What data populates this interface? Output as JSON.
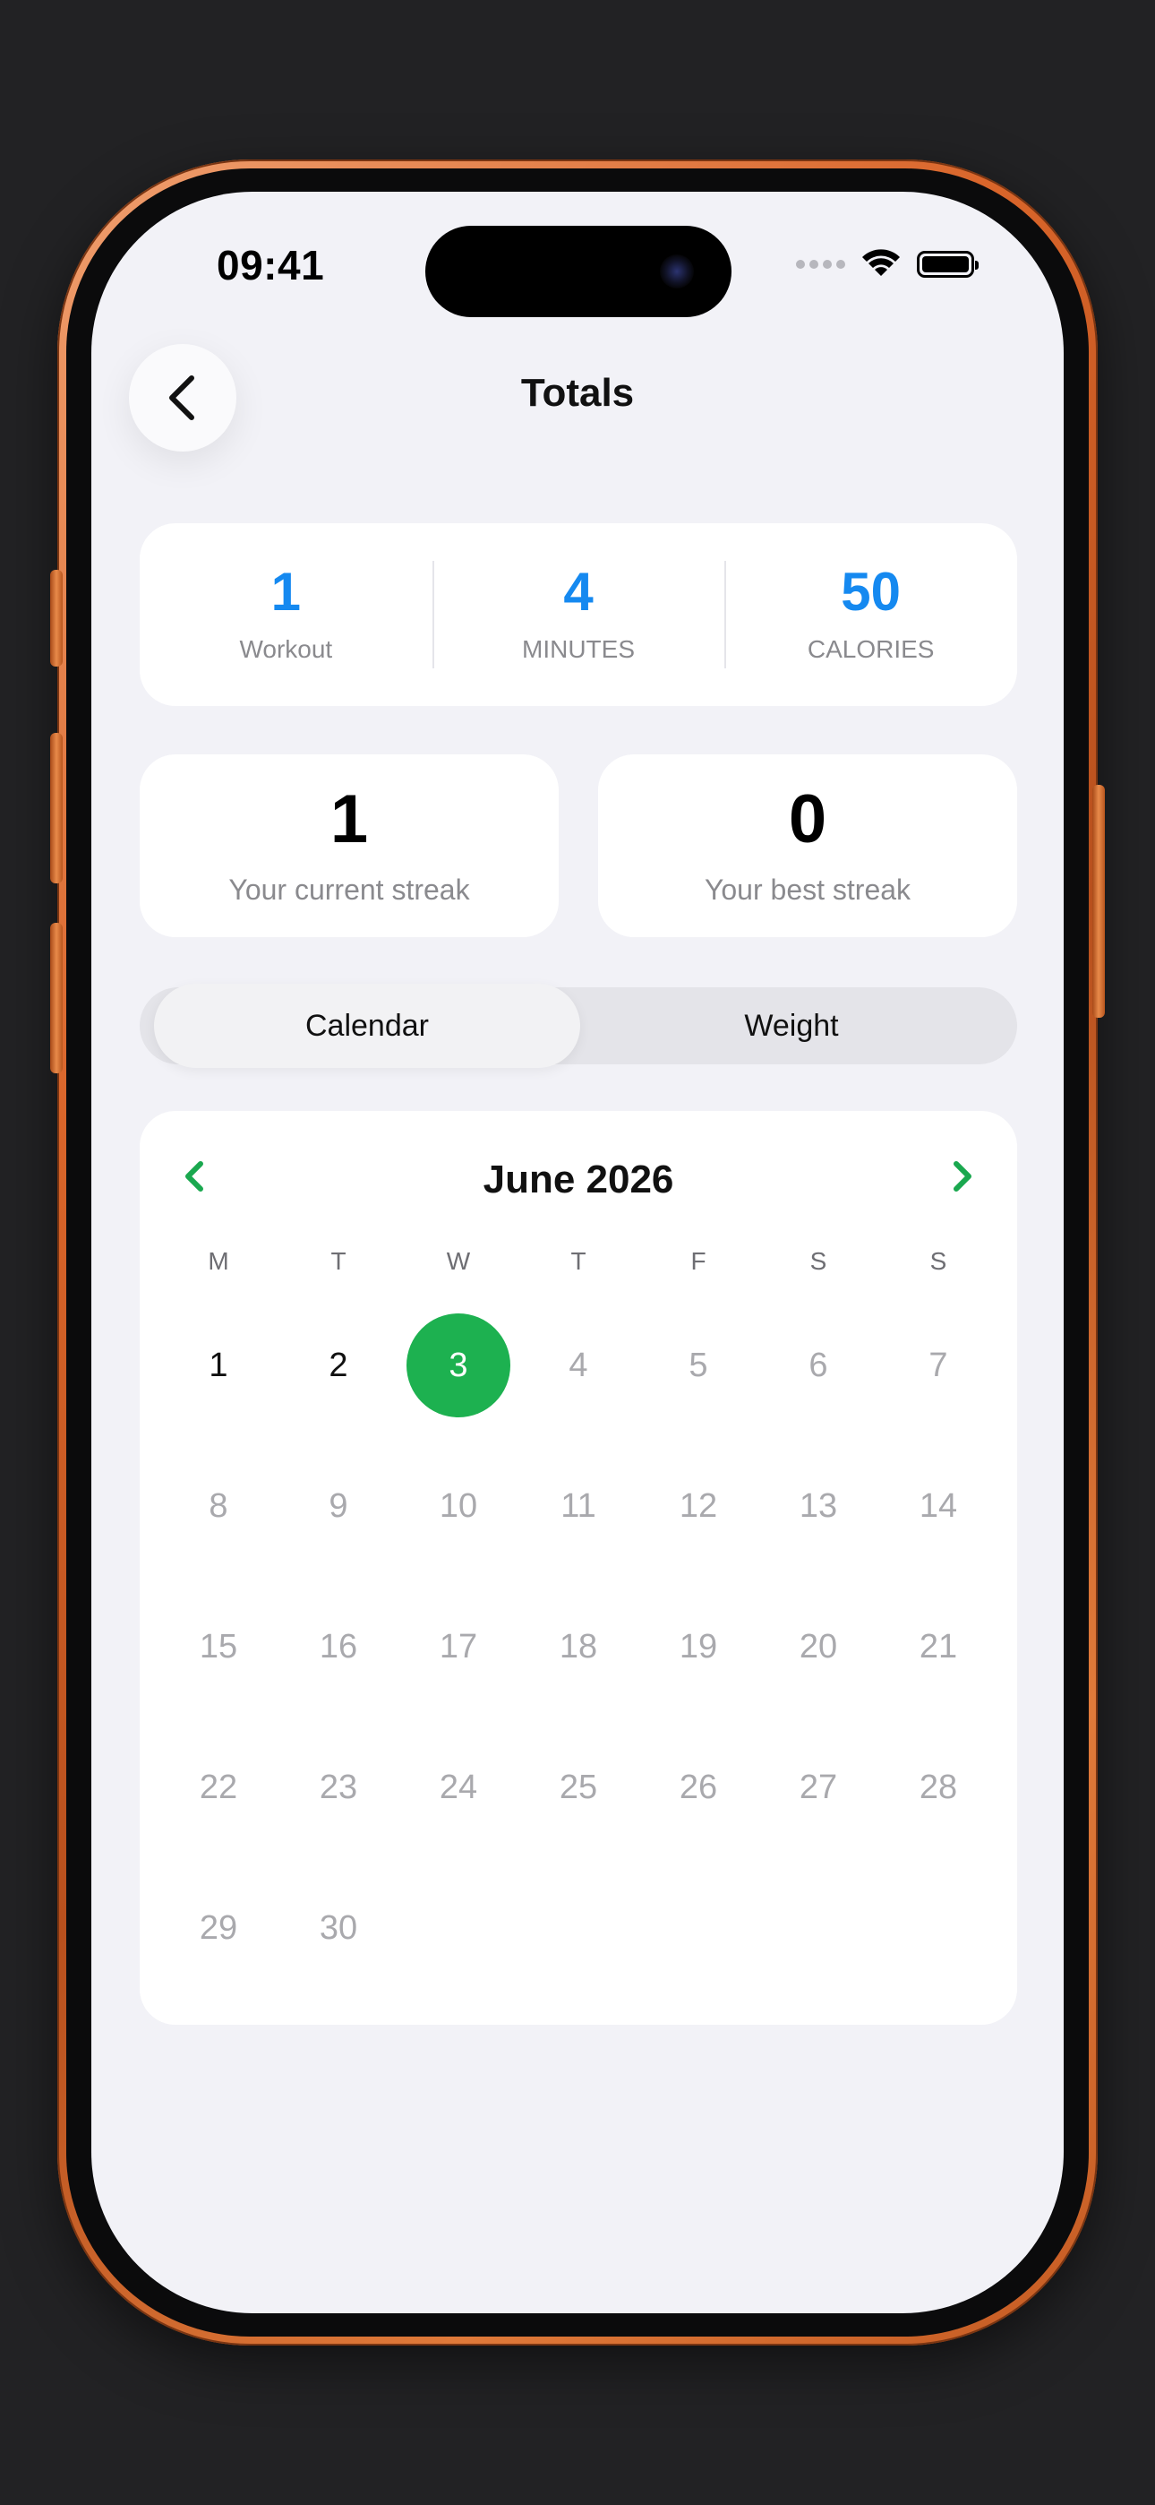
{
  "status_bar": {
    "time": "09:41"
  },
  "header": {
    "title": "Totals",
    "back_icon": "chevron-left-icon"
  },
  "totals": [
    {
      "value": "1",
      "label": "Workout"
    },
    {
      "value": "4",
      "label": "MINUTES"
    },
    {
      "value": "50",
      "label": "CALORIES"
    }
  ],
  "streaks": {
    "current": {
      "value": "1",
      "label": "Your current streak"
    },
    "best": {
      "value": "0",
      "label": "Your best streak"
    }
  },
  "tabs": {
    "items": [
      "Calendar",
      "Weight"
    ],
    "selected": "Calendar"
  },
  "calendar": {
    "month_label": "June 2026",
    "prev_icon": "chevron-left-icon",
    "next_icon": "chevron-right-icon",
    "weekdays": [
      "M",
      "T",
      "W",
      "T",
      "F",
      "S",
      "S"
    ],
    "days": [
      "1",
      "2",
      "3",
      "4",
      "5",
      "6",
      "7",
      "8",
      "9",
      "10",
      "11",
      "12",
      "13",
      "14",
      "15",
      "16",
      "17",
      "18",
      "19",
      "20",
      "21",
      "22",
      "23",
      "24",
      "25",
      "26",
      "27",
      "28",
      "29",
      "30"
    ],
    "active_days": [
      "1",
      "2"
    ],
    "selected_day": "3"
  },
  "colors": {
    "accent_blue": "#1589f0",
    "selected_green": "#1db150",
    "frame_orange": "#d9652a"
  }
}
